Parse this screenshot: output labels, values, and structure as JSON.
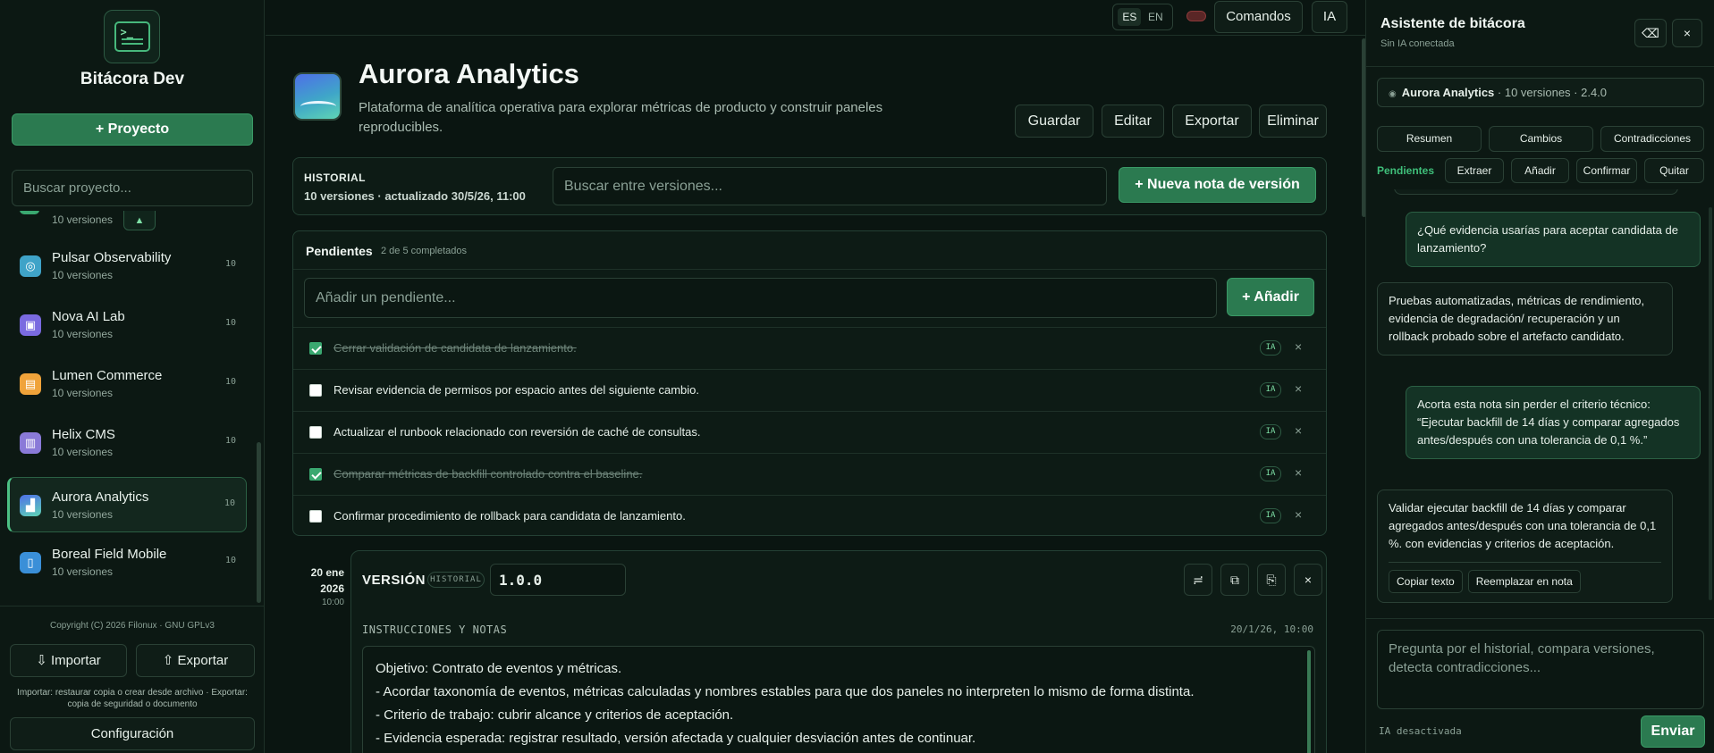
{
  "sidebar": {
    "brand": "Bitácora Dev",
    "new_project": "+ Proyecto",
    "search_placeholder": "Buscar proyecto...",
    "partial_item_sub": "10 versiones",
    "scroll_up": "▲",
    "projects": [
      {
        "name": "Pulsar Observability",
        "sub": "10 versiones",
        "count": "10",
        "icon": "radar-icon",
        "color": "#3fa3c8"
      },
      {
        "name": "Nova AI Lab",
        "sub": "10 versiones",
        "count": "10",
        "icon": "chip-icon",
        "color": "#7a6ae0"
      },
      {
        "name": "Lumen Commerce",
        "sub": "10 versiones",
        "count": "10",
        "icon": "cart-icon",
        "color": "#f0a33a"
      },
      {
        "name": "Helix CMS",
        "sub": "10 versiones",
        "count": "10",
        "icon": "document-icon",
        "color": "#8a7ad8"
      },
      {
        "name": "Aurora Analytics",
        "sub": "10 versiones",
        "count": "10",
        "icon": "chart-icon",
        "color": "#4e8fe0"
      },
      {
        "name": "Boreal Field Mobile",
        "sub": "10 versiones",
        "count": "10",
        "icon": "mobile-icon",
        "color": "#3a8fd8"
      }
    ],
    "copyright": "Copyright (C) 2026 Filonux · GNU GPLv3",
    "import_label": "⇩ Importar",
    "export_label": "⇧ Exportar",
    "import_note": "Importar: restaurar copia o crear desde archivo · Exportar: copia de seguridad o documento",
    "settings_label": "Configuración"
  },
  "topbar": {
    "lang_es": "ES",
    "lang_en": "EN",
    "commands": "Comandos",
    "ai": "IA"
  },
  "project": {
    "title": "Aurora Analytics",
    "description": "Plataforma de analítica operativa para explorar métricas de producto y construir paneles reproducibles.",
    "actions": {
      "save": "Guardar",
      "edit": "Editar",
      "export": "Exportar",
      "delete": "Eliminar"
    }
  },
  "history": {
    "label": "HISTORIAL",
    "meta": "10 versiones · actualizado 30/5/26, 11:00",
    "search_placeholder": "Buscar entre versiones...",
    "new_note": "+ Nueva nota de versión"
  },
  "pending": {
    "title": "Pendientes",
    "count": "2 de 5 completados",
    "input_placeholder": "Añadir un pendiente...",
    "add": "+ Añadir",
    "ia_badge": "IA",
    "remove": "×",
    "tasks": [
      {
        "text": "Cerrar validación de candidata de lanzamiento.",
        "done": true
      },
      {
        "text": "Revisar evidencia de permisos por espacio antes del siguiente cambio.",
        "done": false
      },
      {
        "text": "Actualizar el runbook relacionado con reversión de caché de consultas.",
        "done": false
      },
      {
        "text": "Comparar métricas de backfill controlado contra el baseline.",
        "done": true
      },
      {
        "text": "Confirmar procedimiento de rollback para candidata de lanzamiento.",
        "done": false
      }
    ]
  },
  "version": {
    "date_line1": "20 ene",
    "date_line2": "2026",
    "time": "10:00",
    "label": "VERSIÓN",
    "dot": "·",
    "badge": "HISTORIAL",
    "value": "1.0.0",
    "section_label": "INSTRUCCIONES Y NOTAS",
    "section_date": "20/1/26, 10:00",
    "notes": [
      "Objetivo: Contrato de eventos y métricas.",
      "- Acordar taxonomía de eventos, métricas calculadas y nombres estables para que dos paneles no interpreten lo mismo de forma distinta.",
      "- Criterio de trabajo: cubrir alcance y criterios de aceptación.",
      "- Evidencia esperada: registrar resultado, versión afectada y cualquier desviación antes de continuar."
    ]
  },
  "assistant": {
    "title": "Asistente de bitácora",
    "subtitle": "Sin IA conectada",
    "context_name": "Aurora Analytics",
    "context_meta": " · 10 versiones · 2.4.0",
    "tabs": [
      "Resumen",
      "Cambios",
      "Contradicciones"
    ],
    "pending_label": "Pendientes",
    "pending_actions": [
      "Extraer",
      "Añadir",
      "Confirmar",
      "Quitar"
    ],
    "messages": [
      {
        "role": "user",
        "text": "¿Qué evidencia usarías para aceptar candidata de lanzamiento?"
      },
      {
        "role": "bot",
        "text": "Pruebas automatizadas, métricas de rendimiento, evidencia de degradación/ recuperación y un rollback probado sobre el artefacto candidato."
      },
      {
        "role": "user",
        "text": "Acorta esta nota sin perder el criterio técnico: “Ejecutar backfill de 14 días y comparar agregados antes/después con una tolerancia de 0,1 %.”"
      },
      {
        "role": "bot",
        "text": "Validar ejecutar backfill de 14 días y comparar agregados antes/después con una tolerancia de 0,1 %. con evidencias y criterios de aceptación."
      }
    ],
    "copy_text": "Copiar texto",
    "replace_text": "Reemplazar en nota",
    "input_placeholder": "Pregunta por el historial, compara versiones, detecta contradicciones...",
    "status": "IA desactivada",
    "send": "Enviar"
  },
  "colors": {
    "accent": "#2b7a50",
    "accent_text": "#3fbf7a",
    "background": "#0a1511",
    "danger_toggle": "#5a2626"
  }
}
